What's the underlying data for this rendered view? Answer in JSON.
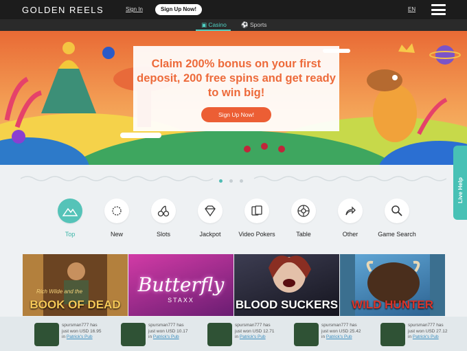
{
  "header": {
    "logo": "GOLDEN REELS",
    "signin": "Sign In",
    "signup": "Sign Up Now!",
    "language": "EN"
  },
  "subnav": {
    "tabs": [
      {
        "label": "Casino",
        "active": true
      },
      {
        "label": "Sports",
        "active": false
      }
    ]
  },
  "hero": {
    "promo_text": "Claim 200% bonus on your first deposit, 200 free spins and get ready to win big!",
    "button": "Sign Up Now!",
    "slides_total": 3,
    "slide_active": 1
  },
  "categories": [
    {
      "label": "Top",
      "icon": "mountain-icon"
    },
    {
      "label": "New",
      "icon": "star-burst-icon"
    },
    {
      "label": "Slots",
      "icon": "cherries-icon"
    },
    {
      "label": "Jackpot",
      "icon": "diamond-icon"
    },
    {
      "label": "Video Pokers",
      "icon": "cards-icon"
    },
    {
      "label": "Table",
      "icon": "roulette-icon"
    },
    {
      "label": "Other",
      "icon": "share-arrow-icon"
    },
    {
      "label": "Game Search",
      "icon": "magnifier-icon"
    }
  ],
  "live_help": "Live Help",
  "games": [
    {
      "title": "BOOK OF DEAD",
      "subtitle": "Rich Wilde and the",
      "color": "#5a3b1d"
    },
    {
      "title": "Butterfly",
      "subtitle": "STAXX",
      "color": "#b33a9a"
    },
    {
      "title": "BLOOD SUCKERS",
      "subtitle": "",
      "color": "#2b2b3b"
    },
    {
      "title": "WILD HUNTER",
      "subtitle": "",
      "color": "#3a7fb3"
    }
  ],
  "winners": [
    {
      "user": "spursman777 has",
      "action": "just won USD 16.95",
      "prefix": "in",
      "game": "Patrick's Pub"
    },
    {
      "user": "spursman777 has",
      "action": "just won USD 10.17",
      "prefix": "in",
      "game": "Patrick's Pub"
    },
    {
      "user": "spursman777 has",
      "action": "just won USD 12.71",
      "prefix": "in",
      "game": "Patrick's Pub"
    },
    {
      "user": "spursman777 has",
      "action": "just won USD 25.42",
      "prefix": "in",
      "game": "Patrick's Pub"
    },
    {
      "user": "spursman777 has",
      "action": "just won USD 27.12",
      "prefix": "in",
      "game": "Patrick's Pub"
    }
  ],
  "colors": {
    "accent": "#4fd0c3",
    "promo": "#ed6a3a",
    "topbar": "#1c1c1c"
  }
}
